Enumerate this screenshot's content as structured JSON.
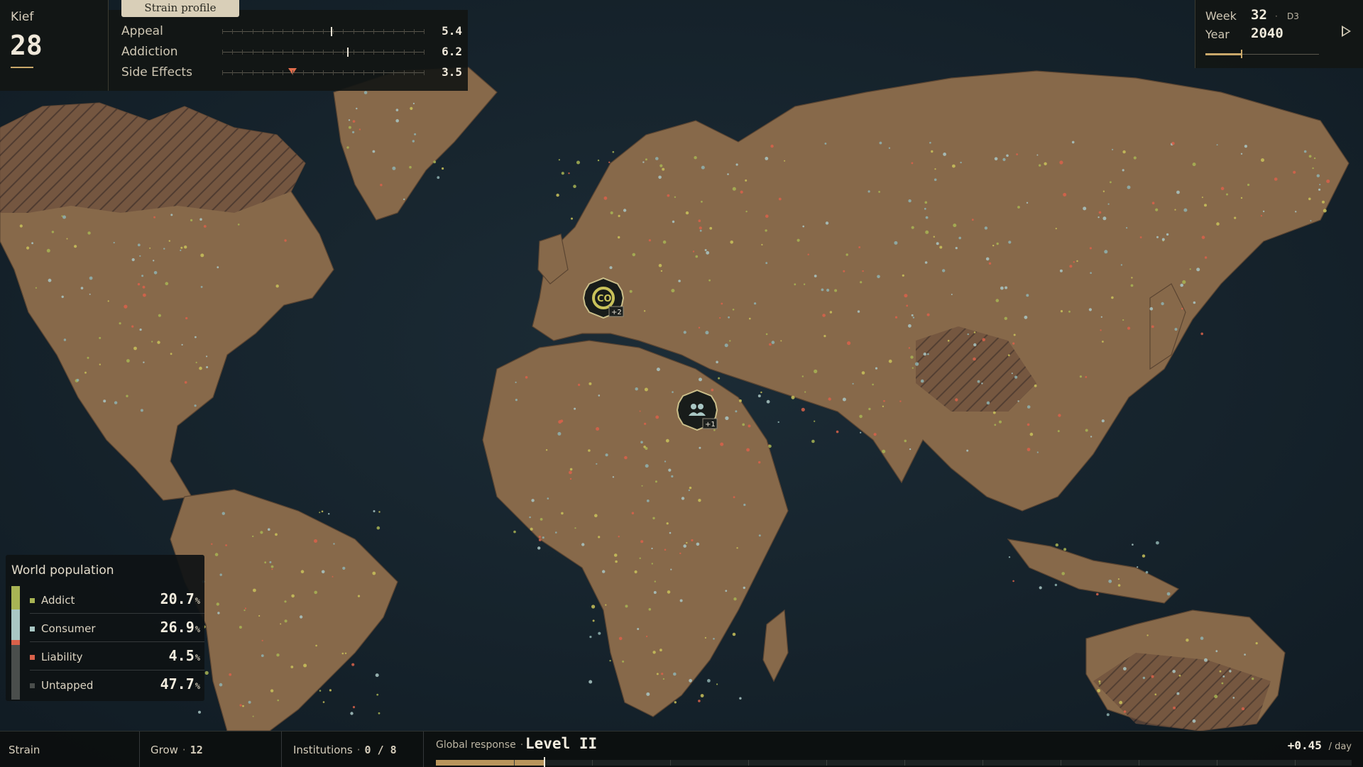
{
  "strain": {
    "name": "Kief",
    "points": "28"
  },
  "profile": {
    "tab_label": "Strain profile",
    "stats": [
      {
        "label": "Appeal",
        "value": "5.4",
        "level": 0.54,
        "marker": "line"
      },
      {
        "label": "Addiction",
        "value": "6.2",
        "level": 0.62,
        "marker": "line"
      },
      {
        "label": "Side Effects",
        "value": "3.5",
        "level": 0.35,
        "marker": "triangle"
      }
    ]
  },
  "time": {
    "week_label": "Week",
    "week": "32",
    "day": "D3",
    "year_label": "Year",
    "year": "2040",
    "progress": 0.31
  },
  "map": {
    "markers": [
      {
        "name": "europe-event",
        "icon": "co-icon",
        "badge": "+2"
      },
      {
        "name": "mideast-event",
        "icon": "people-icon",
        "badge": "+1"
      }
    ]
  },
  "population": {
    "title": "World population",
    "rows": [
      {
        "label": "Addict",
        "value": "20.7",
        "pct": "%",
        "color": "#a8b454",
        "share": 20.7
      },
      {
        "label": "Consumer",
        "value": "26.9",
        "pct": "%",
        "color": "#a9c7c4",
        "share": 26.9
      },
      {
        "label": "Liability",
        "value": "4.5",
        "pct": "%",
        "color": "#d9614a",
        "share": 4.5
      },
      {
        "label": "Untapped",
        "value": "47.7",
        "pct": "%",
        "color": "#4a4e4c",
        "share": 47.7
      }
    ]
  },
  "bottom": {
    "strain_label": "Strain",
    "grow_label": "Grow",
    "grow_value": "12",
    "institutions_label": "Institutions",
    "institutions_value": "0 / 8",
    "response_label": "Global response",
    "response_level": "Level II",
    "response_progress": 0.118,
    "rate": "+0.45",
    "rate_unit": "/ day"
  },
  "colors": {
    "accent": "#c9a86a",
    "ocean": "#16232d",
    "land": "#8a6e49"
  }
}
